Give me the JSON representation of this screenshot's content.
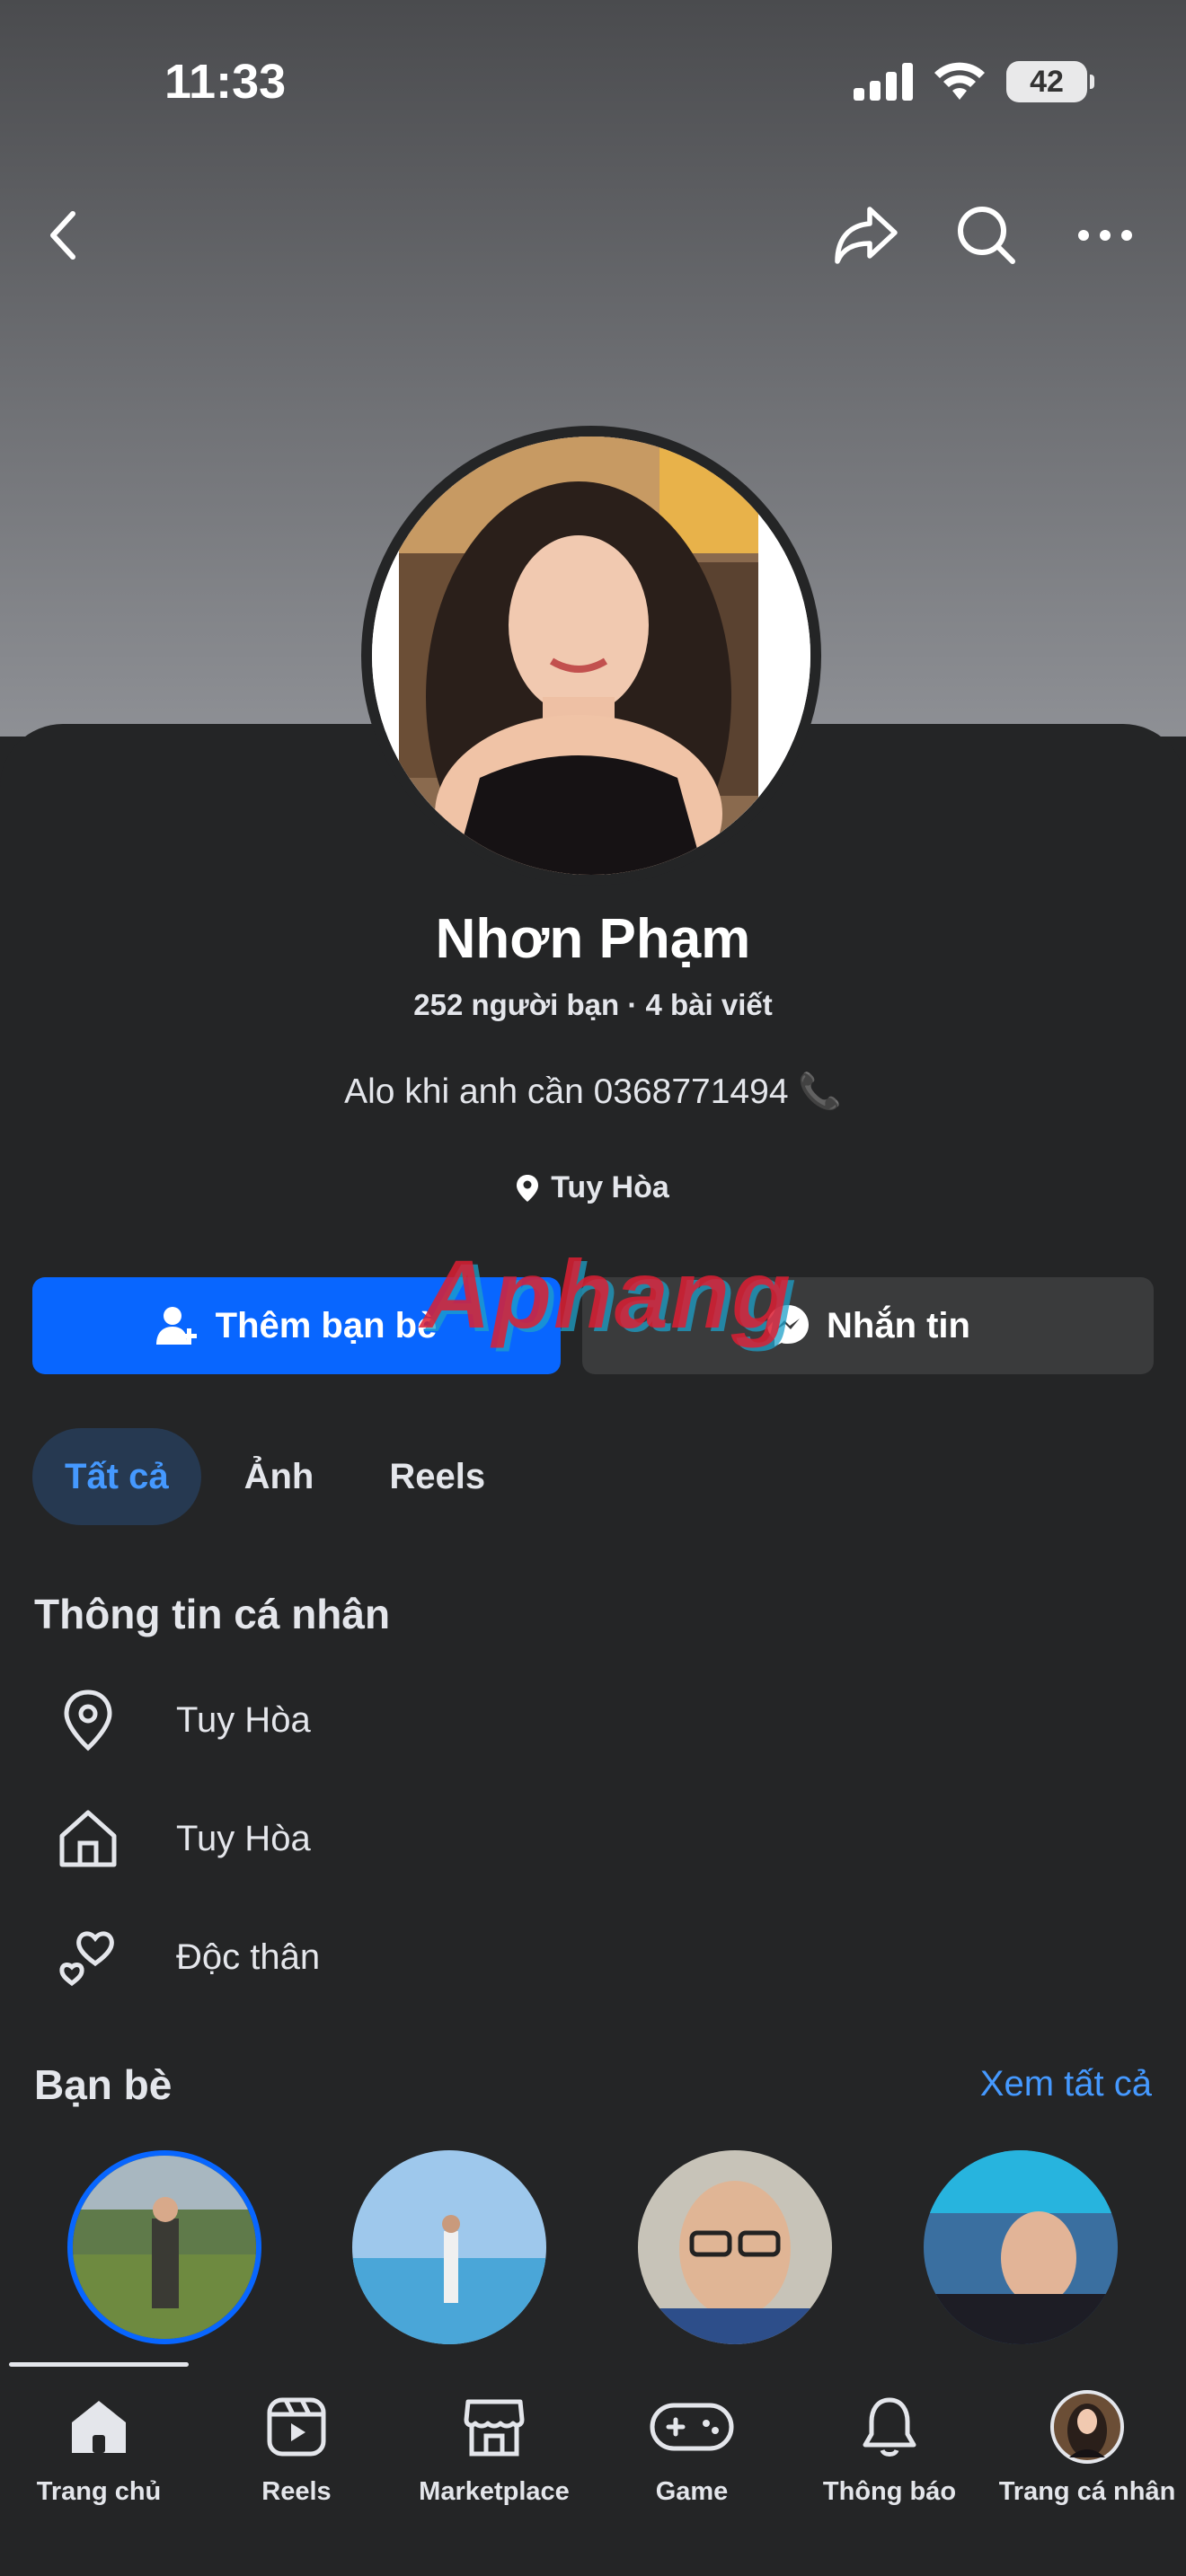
{
  "status_bar": {
    "time": "11:33",
    "battery": "42"
  },
  "profile": {
    "name": "Nhơn Phạm",
    "stats": "252 người bạn · 4 bài viết",
    "bio": "Alo khi anh cần 0368771494 📞",
    "location": "Tuy Hòa"
  },
  "actions": {
    "add_friend": "Thêm bạn bè",
    "message": "Nhắn tin"
  },
  "watermark": "Aphang",
  "tabs": [
    {
      "label": "Tất cả"
    },
    {
      "label": "Ảnh"
    },
    {
      "label": "Reels"
    }
  ],
  "about": {
    "title": "Thông tin cá nhân",
    "items": [
      {
        "icon": "location-pin-icon",
        "text": "Tuy Hòa"
      },
      {
        "icon": "home-icon",
        "text": "Tuy Hòa"
      },
      {
        "icon": "hearts-icon",
        "text": "Độc thân"
      }
    ]
  },
  "friends": {
    "title": "Bạn bè",
    "see_all": "Xem tất cả"
  },
  "bottom_nav": [
    {
      "label": "Trang chủ",
      "icon": "home-icon"
    },
    {
      "label": "Reels",
      "icon": "reels-icon"
    },
    {
      "label": "Marketplace",
      "icon": "marketplace-icon"
    },
    {
      "label": "Game",
      "icon": "gamepad-icon"
    },
    {
      "label": "Thông báo",
      "icon": "bell-icon"
    },
    {
      "label": "Trang cá nhân",
      "icon": "profile-avatar-icon"
    }
  ],
  "colors": {
    "accent": "#0866ff",
    "link": "#4599ff",
    "background": "#242526"
  }
}
